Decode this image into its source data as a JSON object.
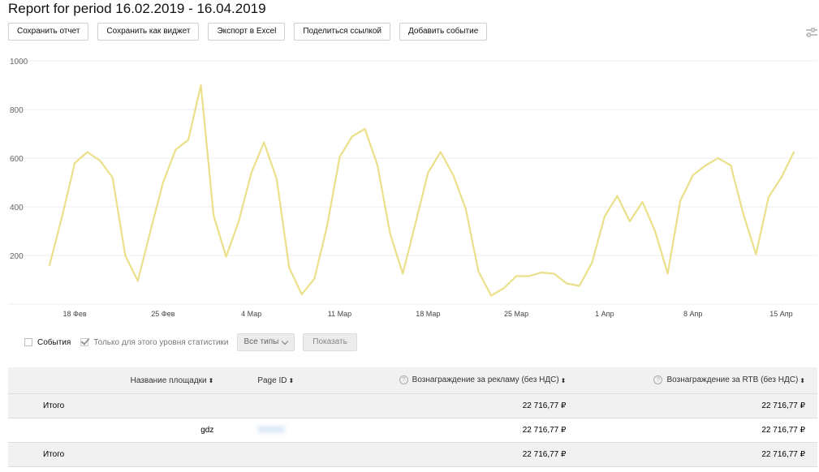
{
  "report": {
    "title": "Report for period 16.02.2019 - 16.04.2019"
  },
  "toolbar": {
    "save_report": "Сохранить отчет",
    "save_widget": "Сохранить как виджет",
    "export_excel": "Экспорт в Excel",
    "share_link": "Поделиться ссылкой",
    "add_event": "Добавить событие",
    "settings_icon": "sliders-icon"
  },
  "chart_data": {
    "type": "line",
    "title": "",
    "xlabel": "",
    "ylabel": "",
    "ylim": [
      0,
      1000
    ],
    "yticks": [
      "1000",
      "800",
      "600",
      "400",
      "200"
    ],
    "xticks": [
      "18 Фев",
      "25 Фев",
      "4 Мар",
      "11 Мар",
      "18 Мар",
      "25 Мар",
      "1 Апр",
      "8 Апр",
      "15 Апр"
    ],
    "grid": true,
    "series_color": "#ebe08a",
    "x": [
      "16.02.2019",
      "17.02.2019",
      "18.02.2019",
      "19.02.2019",
      "20.02.2019",
      "21.02.2019",
      "22.02.2019",
      "23.02.2019",
      "24.02.2019",
      "25.02.2019",
      "26.02.2019",
      "27.02.2019",
      "28.02.2019",
      "01.03.2019",
      "02.03.2019",
      "03.03.2019",
      "04.03.2019",
      "05.03.2019",
      "06.03.2019",
      "07.03.2019",
      "08.03.2019",
      "09.03.2019",
      "10.03.2019",
      "11.03.2019",
      "12.03.2019",
      "13.03.2019",
      "14.03.2019",
      "15.03.2019",
      "16.03.2019",
      "17.03.2019",
      "18.03.2019",
      "19.03.2019",
      "20.03.2019",
      "21.03.2019",
      "22.03.2019",
      "23.03.2019",
      "24.03.2019",
      "25.03.2019",
      "26.03.2019",
      "27.03.2019",
      "28.03.2019",
      "29.03.2019",
      "30.03.2019",
      "31.03.2019",
      "01.04.2019",
      "02.04.2019",
      "03.04.2019",
      "04.04.2019",
      "05.04.2019",
      "06.04.2019",
      "07.04.2019",
      "08.04.2019",
      "09.04.2019",
      "10.04.2019",
      "11.04.2019",
      "12.04.2019",
      "13.04.2019",
      "14.04.2019",
      "15.04.2019",
      "16.04.2019"
    ],
    "series": [
      {
        "values": [
          160,
          360,
          580,
          625,
          590,
          520,
          200,
          95,
          300,
          500,
          635,
          675,
          900,
          365,
          195,
          340,
          540,
          665,
          515,
          150,
          40,
          105,
          320,
          605,
          690,
          720,
          570,
          290,
          125,
          330,
          540,
          625,
          530,
          390,
          135,
          35,
          65,
          115,
          115,
          130,
          125,
          85,
          75,
          170,
          360,
          445,
          340,
          420,
          300,
          125,
          425,
          530,
          570,
          600,
          570,
          370,
          205,
          440,
          520,
          625
        ]
      }
    ]
  },
  "filters": {
    "events_label": "События",
    "only_level_label": "Только для этого уровня статистики",
    "types_select": "Все типы",
    "show_button": "Показать"
  },
  "table": {
    "headers": {
      "site_name": "Название площадки",
      "page_id": "Page ID",
      "ads_reward": "Вознаграждение за рекламу (без НДС)",
      "rtb_reward": "Вознаграждение за RTB (без НДС)"
    },
    "rows": [
      {
        "name": "Итого",
        "page_id": "",
        "ads": "22 716,77 ₽",
        "rtb": "22 716,77 ₽"
      },
      {
        "name": "gdz",
        "page_id": "000000",
        "ads": "22 716,77 ₽",
        "rtb": "22 716,77 ₽"
      },
      {
        "name": "Итого",
        "page_id": "",
        "ads": "22 716,77 ₽",
        "rtb": "22 716,77 ₽"
      }
    ]
  }
}
